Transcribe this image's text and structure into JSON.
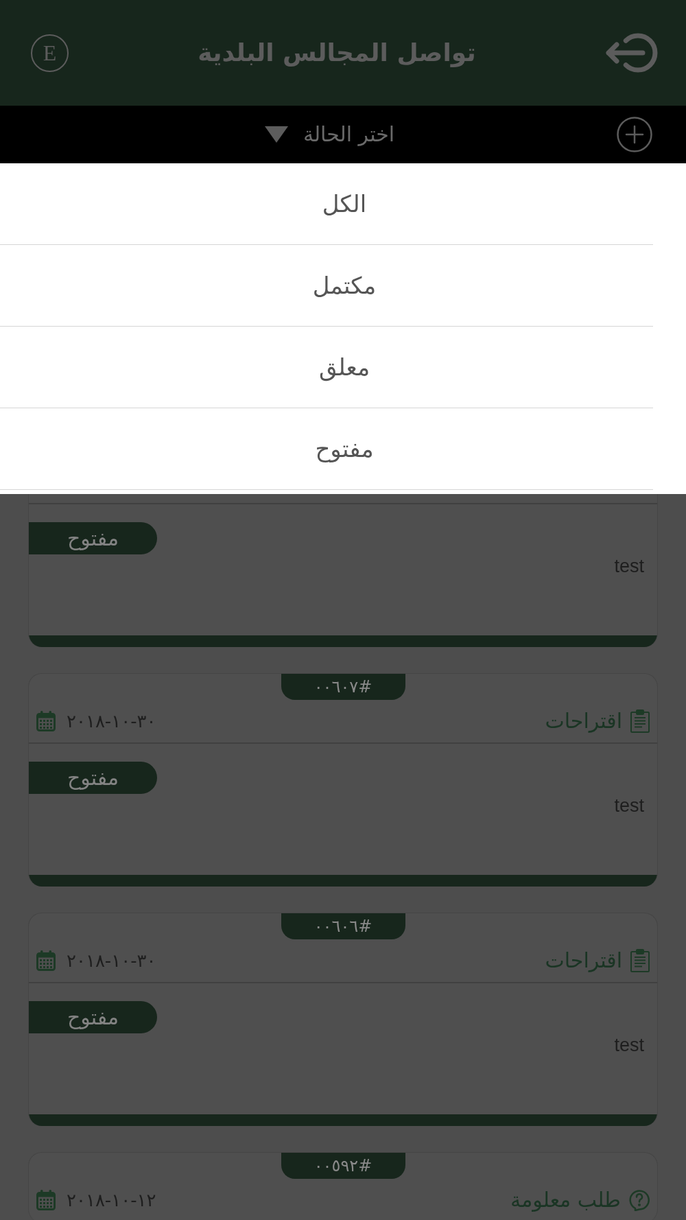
{
  "header": {
    "language_button": "E",
    "title": "تواصل المجالس البلدية"
  },
  "filter_bar": {
    "status_select": "اختر الحالة"
  },
  "status_menu": {
    "items": [
      {
        "label": "الكل",
        "selected": false
      },
      {
        "label": "مكتمل",
        "selected": false
      },
      {
        "label": "معلق",
        "selected": false
      },
      {
        "label": "مفتوح",
        "selected": false
      }
    ]
  },
  "requests": [
    {
      "status": "مفتوح",
      "text": "test"
    },
    {
      "number": "#٠٠٦٠٧",
      "category": {
        "kind": "suggestion",
        "label": "اقتراحات"
      },
      "date": "٣٠-١٠-٢٠١٨",
      "status": "مفتوح",
      "text": "test"
    },
    {
      "number": "#٠٠٦٠٦",
      "category": {
        "kind": "suggestion",
        "label": "اقتراحات"
      },
      "date": "٣٠-١٠-٢٠١٨",
      "status": "مفتوح",
      "text": "test"
    },
    {
      "number": "#٠٠٥٩٢",
      "category": {
        "kind": "inquiry",
        "label": "طلب معلومة"
      },
      "date": "١٢-١٠-٢٠١٨"
    }
  ]
}
